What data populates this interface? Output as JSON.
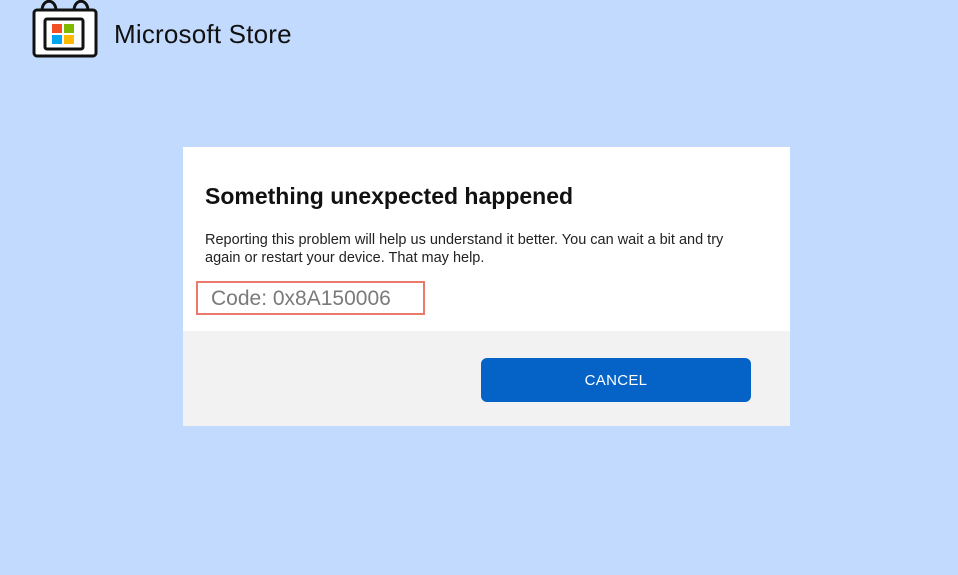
{
  "app": {
    "name": "Microsoft Store",
    "icon": "microsoft-store-bag-icon"
  },
  "dialog": {
    "title": "Something unexpected happened",
    "message": "Reporting this problem will help us understand it better. You can wait a bit and try again or restart your device. That may help.",
    "error_code": "Code: 0x8A150006",
    "cancel_label": "CANCEL"
  },
  "colors": {
    "background": "#c2dafd",
    "button": "#0563c8",
    "highlight_border": "#ea7a6c",
    "footer": "#f2f2f2"
  }
}
